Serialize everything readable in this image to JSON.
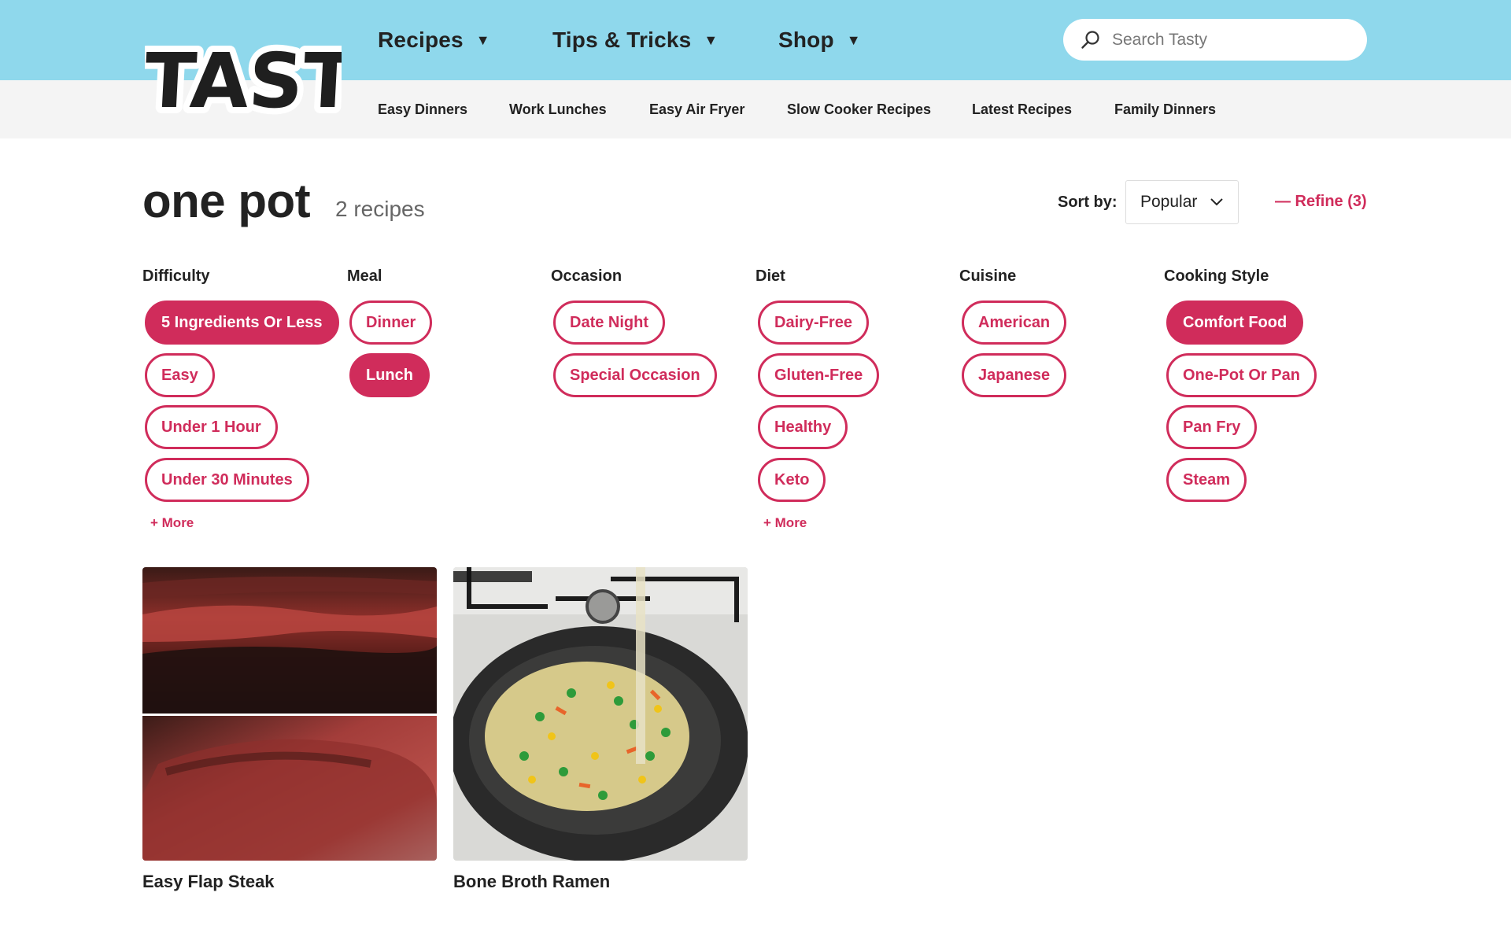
{
  "brand": {
    "logo_text": "TASTY",
    "accent": "#d02c5b",
    "header_bg": "#8fd8ec"
  },
  "main_nav": [
    {
      "label": "Recipes",
      "icon": "caret-down-icon"
    },
    {
      "label": "Tips & Tricks",
      "icon": "caret-down-icon"
    },
    {
      "label": "Shop",
      "icon": "caret-down-icon"
    }
  ],
  "search": {
    "placeholder": "Search Tasty",
    "icon": "search-icon"
  },
  "sub_nav": [
    "Easy Dinners",
    "Work Lunches",
    "Easy Air Fryer",
    "Slow Cooker Recipes",
    "Latest Recipes",
    "Family Dinners"
  ],
  "page": {
    "title": "one pot",
    "count": "2 recipes"
  },
  "sort": {
    "label": "Sort by:",
    "value": "Popular",
    "icon": "chevron-down-icon"
  },
  "refine": {
    "label": "— Refine (3)"
  },
  "filters": [
    {
      "heading": "Difficulty",
      "chips": [
        {
          "label": "5 Ingredients Or Less",
          "active": true
        },
        {
          "label": "Easy",
          "active": false
        },
        {
          "label": "Under 1 Hour",
          "active": false
        },
        {
          "label": "Under 30 Minutes",
          "active": false
        }
      ],
      "more": "+ More"
    },
    {
      "heading": "Meal",
      "chips": [
        {
          "label": "Dinner",
          "active": false
        },
        {
          "label": "Lunch",
          "active": true
        }
      ]
    },
    {
      "heading": "Occasion",
      "chips": [
        {
          "label": "Date Night",
          "active": false
        },
        {
          "label": "Special Occasion",
          "active": false
        }
      ]
    },
    {
      "heading": "Diet",
      "chips": [
        {
          "label": "Dairy-Free",
          "active": false
        },
        {
          "label": "Gluten-Free",
          "active": false
        },
        {
          "label": "Healthy",
          "active": false
        },
        {
          "label": "Keto",
          "active": false
        }
      ],
      "more": "+ More"
    },
    {
      "heading": "Cuisine",
      "chips": [
        {
          "label": "American",
          "active": false
        },
        {
          "label": "Japanese",
          "active": false
        }
      ]
    },
    {
      "heading": "Cooking Style",
      "chips": [
        {
          "label": "Comfort Food",
          "active": true
        },
        {
          "label": "One-Pot Or Pan",
          "active": false
        },
        {
          "label": "Pan Fry",
          "active": false
        },
        {
          "label": "Steam",
          "active": false
        }
      ]
    }
  ],
  "recipes": [
    {
      "title": "Easy Flap Steak",
      "image": "steak-photo"
    },
    {
      "title": "Bone Broth Ramen",
      "image": "ramen-pan-photo"
    }
  ]
}
